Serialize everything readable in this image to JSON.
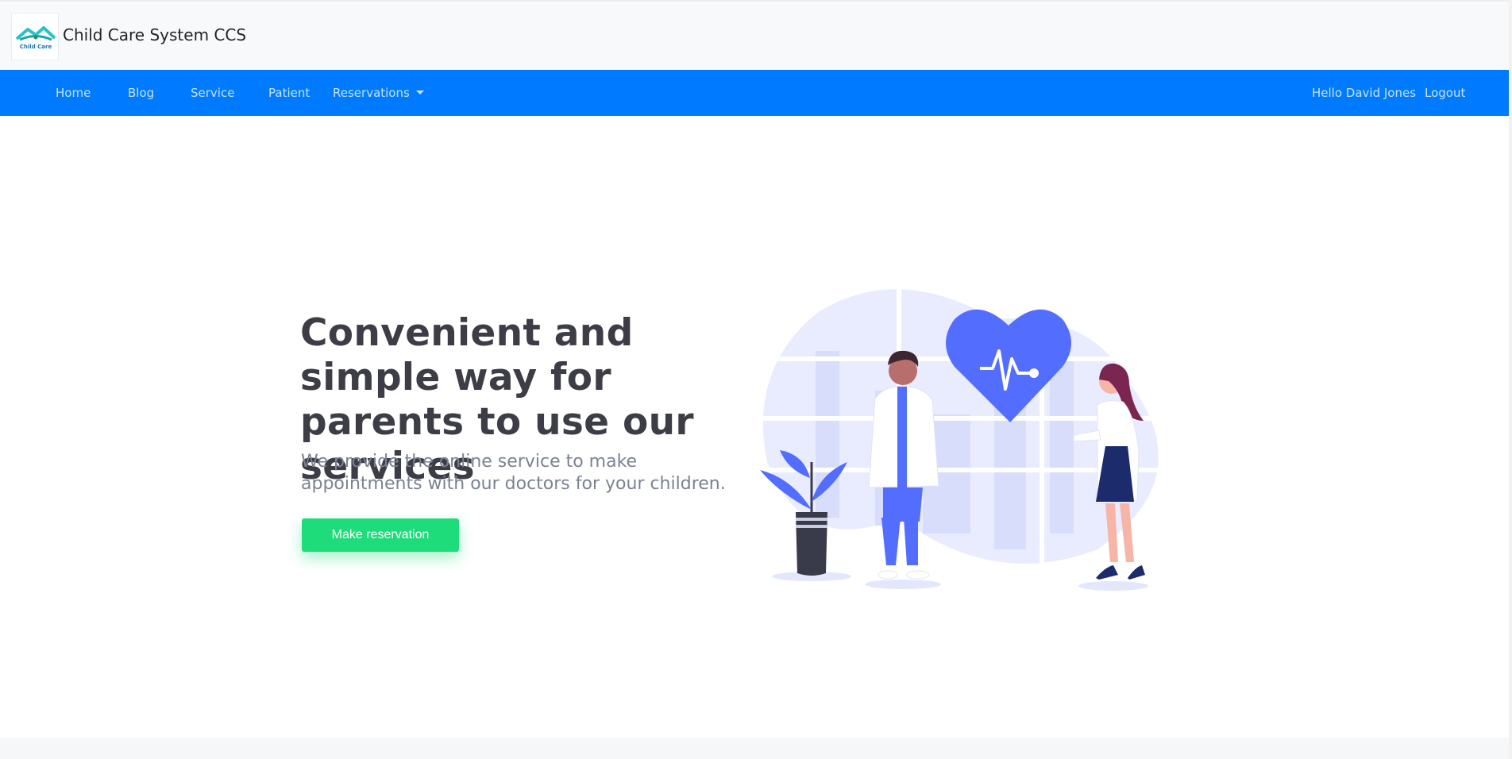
{
  "brand": {
    "logo_text": "Child Care",
    "title": "Child Care System CCS"
  },
  "nav": {
    "items": [
      {
        "label": "Home"
      },
      {
        "label": "Blog"
      },
      {
        "label": "Service"
      },
      {
        "label": "Patient"
      },
      {
        "label": "Reservations"
      }
    ],
    "greeting": "Hello David Jones",
    "logout": "Logout"
  },
  "hero": {
    "title": "Convenient and simple way for parents to use our services",
    "subtitle": "We provide the online service to make appointments with our doctors for your children.",
    "button": "Make reservation"
  },
  "colors": {
    "nav_bg": "#007bff",
    "button": "#1fdc7b",
    "illustration_accent": "#536dfe"
  }
}
